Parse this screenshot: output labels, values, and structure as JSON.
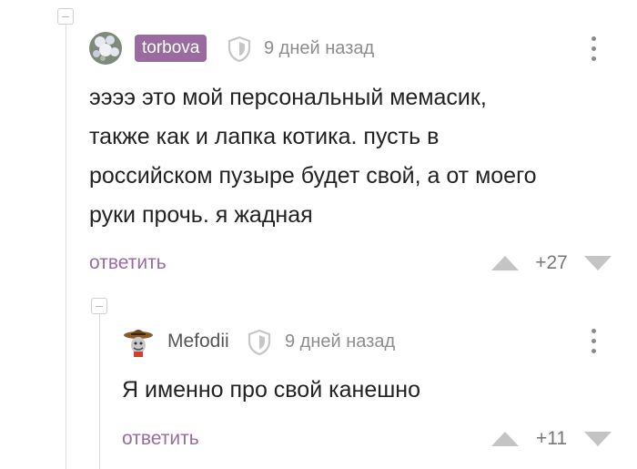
{
  "comment_1": {
    "username": "torbova",
    "time": "9 дней назад",
    "text_lines": [
      "ээээ это мой персональный мемасик,",
      "также как и лапка котика. пусть в",
      "российском пузыре будет свой, а от моего",
      "руки прочь. я жадная"
    ],
    "reply_label": "ответить",
    "rating": "+27"
  },
  "comment_2": {
    "username": "Mefodii",
    "time": "9 дней назад",
    "text": "Я именно про свой канешно",
    "reply_label": "ответить",
    "rating": "+11"
  },
  "colors": {
    "accent": "#9a6b9e",
    "muted_text": "#8d8d8d",
    "thread_line": "#dcdcdc",
    "vote_arrow": "#c4c4c4"
  },
  "icons": {
    "shield": "shield-icon",
    "more": "kebab-menu-icon",
    "upvote": "upvote-arrow-icon",
    "downvote": "downvote-arrow-icon",
    "collapse": "collapse-thread-icon"
  }
}
